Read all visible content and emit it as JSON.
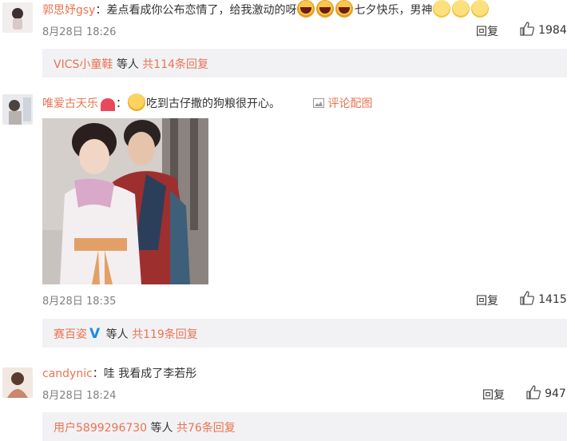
{
  "comments": [
    {
      "user": "郭思妤gsy",
      "text_a": "：差点看成你公布恋情了，给我激动的呀",
      "text_b": "七夕快乐，男神",
      "time": "8月28日 18:26",
      "reply_label": "回复",
      "likes": "1984",
      "thread": {
        "user": "VICS小童鞋",
        "mid": " 等人 ",
        "count": "共114条回复"
      }
    },
    {
      "user": "唯爱古天乐",
      "text": "吃到古仔撒的狗粮很开心。",
      "pic_link": "评论配图",
      "time": "8月28日 18:35",
      "reply_label": "回复",
      "likes": "1415",
      "thread": {
        "user": "赛百姿",
        "mid": " 等人 ",
        "count": "共119条回复"
      }
    },
    {
      "user": "candynic",
      "text": "：哇 我看成了李若彤",
      "time": "8月28日 18:24",
      "reply_label": "回复",
      "likes": "947",
      "thread": {
        "user": "用户5899296730",
        "mid": " 等人 ",
        "count": "共76条回复"
      }
    }
  ],
  "colors": {
    "username": "#eb7350",
    "verified": "#1a8be8",
    "bar": "#f2f2f5"
  }
}
